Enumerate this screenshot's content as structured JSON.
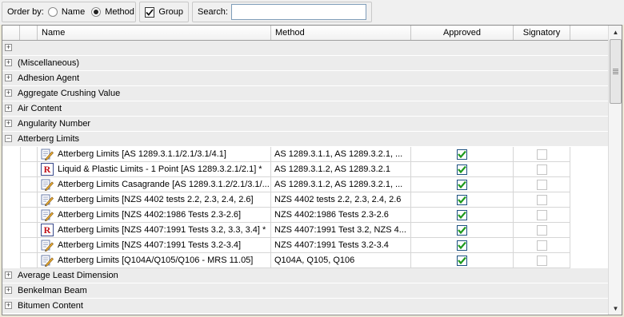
{
  "toolbar": {
    "order_by_label": "Order by:",
    "order_options": [
      {
        "label": "Name",
        "selected": false
      },
      {
        "label": "Method",
        "selected": true
      }
    ],
    "group_label": "Group",
    "group_checked": true,
    "search_label": "Search:",
    "search_value": ""
  },
  "columns": {
    "name": "Name",
    "method": "Method",
    "approved": "Approved",
    "signatory": "Signatory"
  },
  "groups": [
    {
      "label": "",
      "expanded": false
    },
    {
      "label": "(Miscellaneous)",
      "expanded": false
    },
    {
      "label": "Adhesion Agent",
      "expanded": false
    },
    {
      "label": "Aggregate Crushing Value",
      "expanded": false
    },
    {
      "label": "Air Content",
      "expanded": false
    },
    {
      "label": "Angularity Number",
      "expanded": false
    },
    {
      "label": "Atterberg Limits",
      "expanded": true,
      "items": [
        {
          "icon": "pencil-document-icon",
          "name": "Atterberg Limits [AS 1289.3.1.1/2.1/3.1/4.1]",
          "method": "AS 1289.3.1.1, AS 1289.3.2.1, ...",
          "approved": true,
          "signatory": false
        },
        {
          "icon": "report-r-icon",
          "name": "Liquid & Plastic Limits - 1 Point [AS 1289.3.2.1/2.1] *",
          "method": "AS 1289.3.1.2, AS 1289.3.2.1",
          "approved": true,
          "signatory": false
        },
        {
          "icon": "pencil-document-icon",
          "name": "Atterberg Limits Casagrande [AS 1289.3.1.2/2.1/3.1/...",
          "method": "AS 1289.3.1.2, AS 1289.3.2.1, ...",
          "approved": true,
          "signatory": false
        },
        {
          "icon": "pencil-document-icon",
          "name": "Atterberg Limits [NZS 4402 tests 2.2, 2.3, 2.4, 2.6]",
          "method": "NZS 4402 tests 2.2, 2.3, 2.4, 2.6",
          "approved": true,
          "signatory": false
        },
        {
          "icon": "pencil-document-icon",
          "name": "Atterberg Limits [NZS 4402:1986 Tests 2.3-2.6]",
          "method": "NZS 4402:1986 Tests 2.3-2.6",
          "approved": true,
          "signatory": false
        },
        {
          "icon": "report-r-icon",
          "name": "Atterberg Limits [NZS 4407:1991 Tests 3.2, 3.3, 3.4] *",
          "method": "NZS 4407:1991 Test 3.2, NZS 4...",
          "approved": true,
          "signatory": false
        },
        {
          "icon": "pencil-document-icon",
          "name": "Atterberg Limits [NZS 4407:1991 Tests 3.2-3.4]",
          "method": "NZS 4407:1991 Tests 3.2-3.4",
          "approved": true,
          "signatory": false
        },
        {
          "icon": "pencil-document-icon",
          "name": "Atterberg Limits [Q104A/Q105/Q106 - MRS 11.05]",
          "method": "Q104A, Q105, Q106",
          "approved": true,
          "signatory": false
        }
      ]
    },
    {
      "label": "Average Least Dimension",
      "expanded": false
    },
    {
      "label": "Benkelman Beam",
      "expanded": false
    },
    {
      "label": "Bitumen Content",
      "expanded": false
    }
  ],
  "colors": {
    "check": "#1e9a1e",
    "group_bg": "#ececec"
  }
}
